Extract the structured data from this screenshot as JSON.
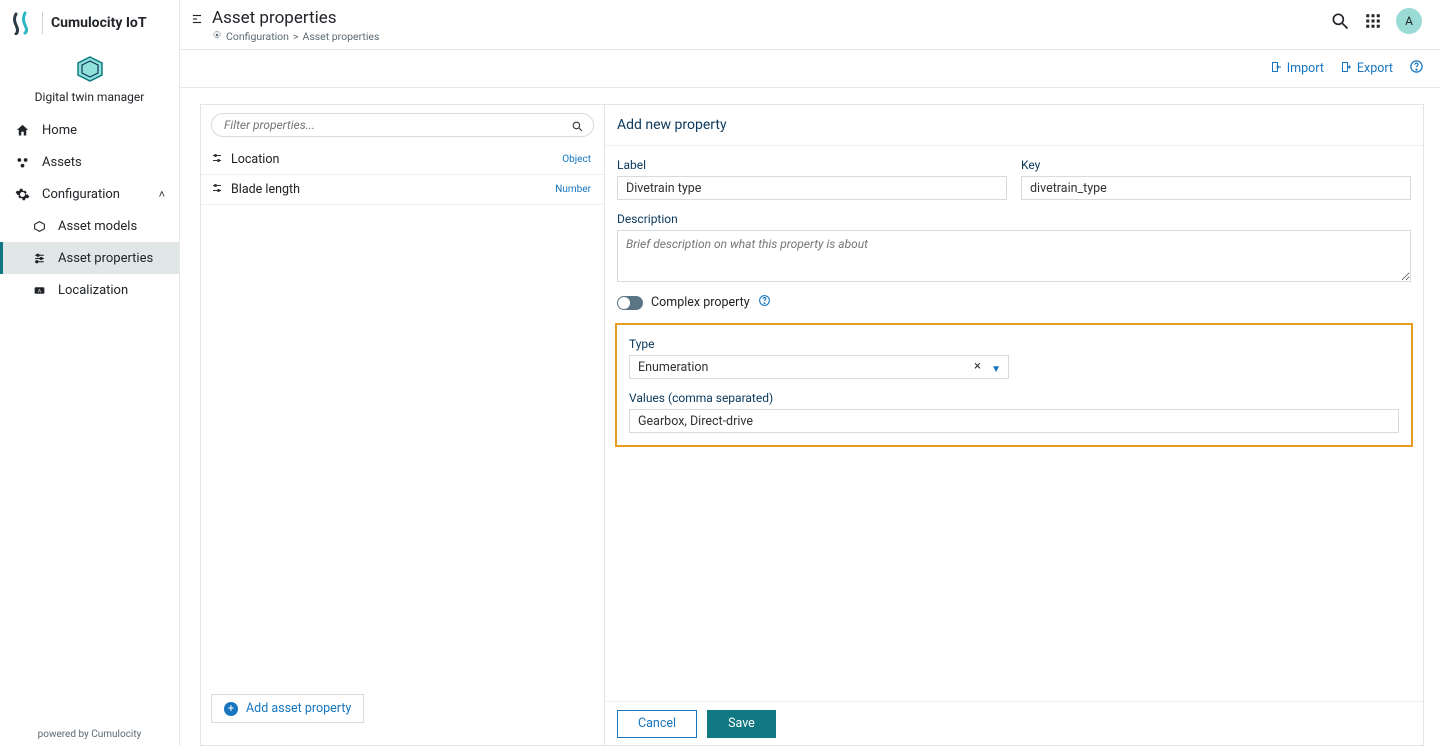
{
  "brand": {
    "name": "Cumulocity IoT",
    "app_title": "Digital twin manager"
  },
  "sidebar": {
    "home": "Home",
    "assets": "Assets",
    "configuration": "Configuration",
    "children": {
      "asset_models": "Asset models",
      "asset_properties": "Asset properties",
      "localization": "Localization"
    },
    "footer": "powered by Cumulocity"
  },
  "header": {
    "title": "Asset properties",
    "breadcrumbs": {
      "root": "Configuration",
      "current": "Asset properties"
    }
  },
  "actionbar": {
    "import": "Import",
    "export": "Export"
  },
  "avatar": "A",
  "listPanel": {
    "filter_placeholder": "Filter properties...",
    "items": [
      {
        "name": "Location",
        "type": "Object"
      },
      {
        "name": "Blade length",
        "type": "Number"
      }
    ],
    "add_label": "Add asset property"
  },
  "form": {
    "title": "Add new property",
    "labels": {
      "label": "Label",
      "key": "Key",
      "description": "Description",
      "complex": "Complex property",
      "type": "Type",
      "values": "Values (comma separated)"
    },
    "values": {
      "label": "Divetrain type",
      "key": "divetrain_type",
      "type": "Enumeration",
      "values": "Gearbox, Direct-drive"
    },
    "placeholders": {
      "description": "Brief description on what this property is about"
    },
    "buttons": {
      "cancel": "Cancel",
      "save": "Save"
    }
  }
}
